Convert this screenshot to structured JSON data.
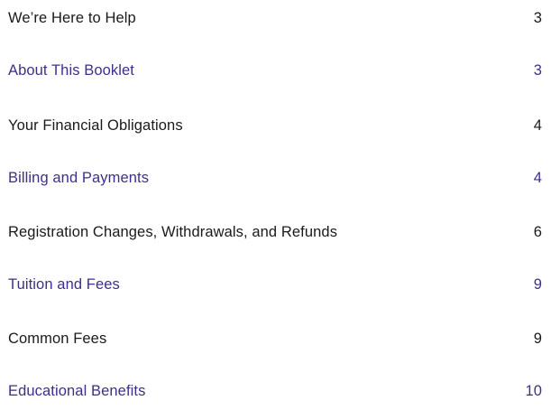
{
  "toc": {
    "entries": [
      {
        "title": "We’re Here to Help",
        "page": "3",
        "style": "plain"
      },
      {
        "title": "About This Booklet",
        "page": "3",
        "style": "accent"
      },
      {
        "title": "Your Financial Obligations",
        "page": "4",
        "style": "plain"
      },
      {
        "title": "Billing and Payments",
        "page": "4",
        "style": "accent"
      },
      {
        "title": "Registration Changes, Withdrawals, and Refunds",
        "page": "6",
        "style": "plain"
      },
      {
        "title": "Tuition and Fees",
        "page": "9",
        "style": "accent"
      },
      {
        "title": "Common Fees",
        "page": "9",
        "style": "plain"
      },
      {
        "title": "Educational Benefits",
        "page": "10",
        "style": "accent"
      }
    ],
    "colors": {
      "plain_text": "#1a1a1a",
      "accent_text": "#3d2f8c",
      "background": "#ffffff"
    }
  }
}
